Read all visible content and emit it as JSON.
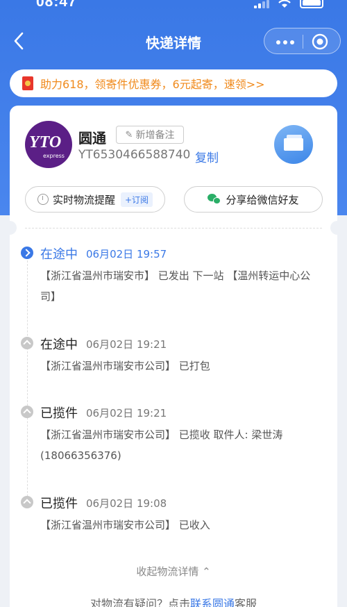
{
  "status_bar": {
    "time": "08:47"
  },
  "nav": {
    "title": "快递详情"
  },
  "promo": {
    "text": "助力618，领寄件优惠券，6元起寄，速领>>"
  },
  "carrier": {
    "name": "圆通",
    "logo_text": "YTO",
    "logo_sub": "express",
    "note_button": "新增备注",
    "tracking_number": "YT6530466588740",
    "copy_label": "复制"
  },
  "actions": {
    "reminder_label": "实时物流提醒",
    "subscribe_tag": "+订阅",
    "share_label": "分享给微信好友"
  },
  "timeline": [
    {
      "status": "在途中",
      "time": "06月02日 19:57",
      "desc": "【浙江省温州市瑞安市】 已发出 下一站 【温州转运中心公司】",
      "active": true
    },
    {
      "status": "在途中",
      "time": "06月02日 19:21",
      "desc": "【浙江省温州市瑞安市公司】 已打包",
      "active": false
    },
    {
      "status": "已揽件",
      "time": "06月02日 19:21",
      "desc": "【浙江省温州市瑞安市公司】 已揽收 取件人: 梁世涛 (18066356376)",
      "active": false
    },
    {
      "status": "已揽件",
      "time": "06月02日 19:08",
      "desc": "【浙江省温州市瑞安市公司】 已收入",
      "active": false
    }
  ],
  "collapse_label": "收起物流详情 ⌃",
  "footer": {
    "prefix": "对物流有疑问？点击",
    "link": "联系圆通",
    "suffix": "客服"
  },
  "colors": {
    "primary": "#3a78e6",
    "promo_text": "#f08a1c"
  }
}
